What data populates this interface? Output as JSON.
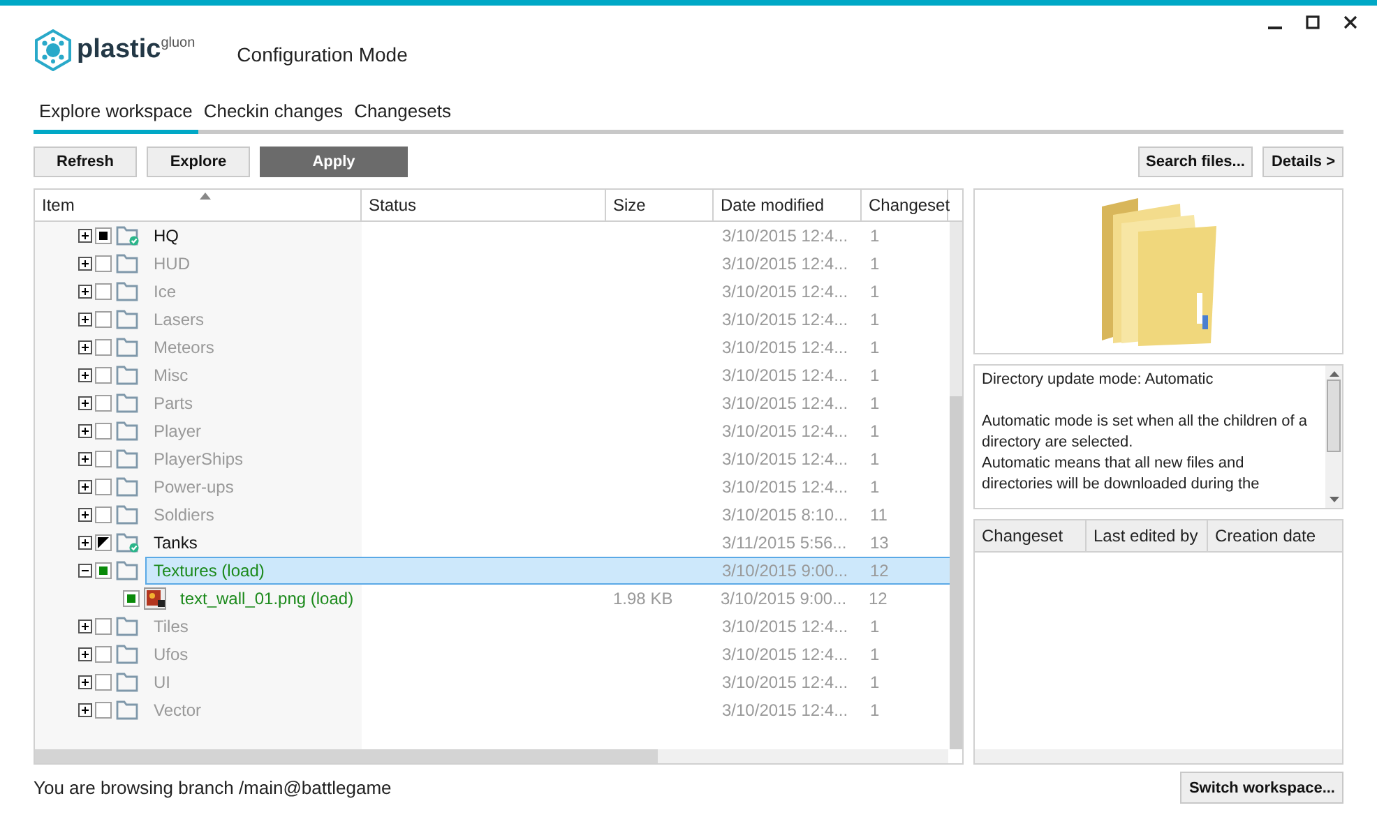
{
  "app": {
    "logo": "plastic$^{gluon}$",
    "mode_title": "Configuration Mode"
  },
  "tabs": [
    {
      "label": "Explore workspace",
      "selected": true
    },
    {
      "label": "Checkin changes",
      "selected": false
    },
    {
      "label": "Changesets",
      "selected": false
    }
  ],
  "toolbar": {
    "left": [
      {
        "label": "Refresh",
        "kind": "normal"
      },
      {
        "label": "Explore",
        "kind": "normal"
      },
      {
        "label": "Apply",
        "kind": "primary"
      }
    ],
    "right": [
      {
        "label": "Search files..."
      },
      {
        "label": "Details >"
      }
    ]
  },
  "tree": {
    "columns": [
      "Item",
      "Status",
      "Size",
      "Date modified",
      "Changeset"
    ],
    "rows": [
      {
        "name": "HQ",
        "checked": true,
        "loaded": true,
        "pending": false,
        "expanded": false,
        "selected": false,
        "date": "3/10/2015 12:4...",
        "changeset": "1"
      },
      {
        "name": "HUD",
        "checked": false,
        "loaded": false,
        "pending": false,
        "expanded": false,
        "selected": false,
        "date": "3/10/2015 12:4...",
        "changeset": "1"
      },
      {
        "name": "Ice",
        "checked": false,
        "loaded": false,
        "pending": false,
        "expanded": false,
        "selected": false,
        "date": "3/10/2015 12:4...",
        "changeset": "1"
      },
      {
        "name": "Lasers",
        "checked": false,
        "loaded": false,
        "pending": false,
        "expanded": false,
        "selected": false,
        "date": "3/10/2015 12:4...",
        "changeset": "1"
      },
      {
        "name": "Meteors",
        "checked": false,
        "loaded": false,
        "pending": false,
        "expanded": false,
        "selected": false,
        "date": "3/10/2015 12:4...",
        "changeset": "1"
      },
      {
        "name": "Misc",
        "checked": false,
        "loaded": false,
        "pending": false,
        "expanded": false,
        "selected": false,
        "date": "3/10/2015 12:4...",
        "changeset": "1"
      },
      {
        "name": "Parts",
        "checked": false,
        "loaded": false,
        "pending": false,
        "expanded": false,
        "selected": false,
        "date": "3/10/2015 12:4...",
        "changeset": "1"
      },
      {
        "name": "Player",
        "checked": false,
        "loaded": false,
        "pending": false,
        "expanded": false,
        "selected": false,
        "date": "3/10/2015 12:4...",
        "changeset": "1"
      },
      {
        "name": "PlayerShips",
        "checked": false,
        "loaded": false,
        "pending": false,
        "expanded": false,
        "selected": false,
        "date": "3/10/2015 12:4...",
        "changeset": "1"
      },
      {
        "name": "Power-ups",
        "checked": false,
        "loaded": false,
        "pending": false,
        "expanded": false,
        "selected": false,
        "date": "3/10/2015 12:4...",
        "changeset": "1"
      },
      {
        "name": "Soldiers",
        "checked": false,
        "loaded": false,
        "pending": false,
        "expanded": false,
        "selected": false,
        "date": "3/10/2015 8:10...",
        "changeset": "11"
      },
      {
        "name": "Tanks",
        "partial": true,
        "loaded": true,
        "pending": false,
        "expanded": false,
        "selected": false,
        "date": "3/11/2015 5:56...",
        "changeset": "13"
      },
      {
        "name": "Textures (load)",
        "checked": true,
        "loaded": false,
        "pending": true,
        "expanded": true,
        "selected": true,
        "date": "3/10/2015 9:00...",
        "changeset": "12",
        "children": [
          {
            "name": "text_wall_01.png (load)",
            "kind": "image",
            "checked": true,
            "pending": true,
            "selected": false,
            "size": "1.98 KB",
            "date": "3/10/2015 9:00...",
            "changeset": "12"
          }
        ]
      },
      {
        "name": "Tiles",
        "checked": false,
        "loaded": false,
        "pending": false,
        "expanded": false,
        "selected": false,
        "date": "3/10/2015 12:4...",
        "changeset": "1"
      },
      {
        "name": "Ufos",
        "checked": false,
        "loaded": false,
        "pending": false,
        "expanded": false,
        "selected": false,
        "date": "3/10/2015 12:4...",
        "changeset": "1"
      },
      {
        "name": "UI",
        "checked": false,
        "loaded": false,
        "pending": false,
        "expanded": false,
        "selected": false,
        "date": "3/10/2015 12:4...",
        "changeset": "1"
      },
      {
        "name": "Vector",
        "checked": false,
        "loaded": false,
        "pending": false,
        "expanded": false,
        "selected": false,
        "date": "3/10/2015 12:4...",
        "changeset": "1"
      }
    ]
  },
  "info": {
    "mode": "Directory update mode: Automatic",
    "description": [
      "Automatic mode is set when all the children of a directory are selected.",
      "Automatic means that all new files and directories will be downloaded during the"
    ]
  },
  "history": {
    "columns": [
      "Changeset",
      "Last edited by",
      "Creation date"
    ]
  },
  "status_bar": {
    "text": "You are browsing branch /main@battlegame",
    "button": "Switch workspace..."
  }
}
